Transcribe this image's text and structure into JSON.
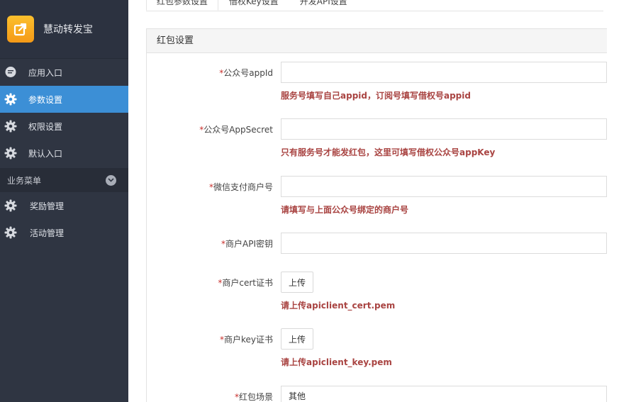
{
  "sidebar": {
    "brand": "慧动转发宝",
    "items": [
      {
        "label": "应用入口"
      },
      {
        "label": "参数设置"
      },
      {
        "label": "权限设置"
      },
      {
        "label": "默认入口"
      }
    ],
    "group_label": "业务菜单",
    "group_items": [
      {
        "label": "奖励管理"
      },
      {
        "label": "活动管理"
      }
    ]
  },
  "tabs": [
    {
      "label": "红包参数设置"
    },
    {
      "label": "借权Key设置"
    },
    {
      "label": "开发API设置"
    }
  ],
  "panel": {
    "title": "红包设置",
    "fields": [
      {
        "required": "*",
        "label": "公众号appId",
        "value": "",
        "help": "服务号填写自己appid，订阅号填写借权号appid"
      },
      {
        "required": "*",
        "label": "公众号AppSecret",
        "value": "",
        "help": "只有服务号才能发红包，这里可填写借权公众号appKey"
      },
      {
        "required": "*",
        "label": "微信支付商户号",
        "value": "",
        "help": "请填写与上面公众号绑定的商户号"
      },
      {
        "required": "*",
        "label": "商户API密钥",
        "value": ""
      },
      {
        "required": "*",
        "label": "商户cert证书",
        "button": "上传",
        "help": "请上传apiclient_cert.pem"
      },
      {
        "required": "*",
        "label": "商户key证书",
        "button": "上传",
        "help": "请上传apiclient_key.pem"
      },
      {
        "required": "*",
        "label": "红包场景",
        "selected": "其他"
      }
    ]
  },
  "colors": {
    "sidebar_bg": "#2f3542",
    "active": "#3c8fd6",
    "help_text": "#a94442",
    "required": "#c9302c"
  }
}
